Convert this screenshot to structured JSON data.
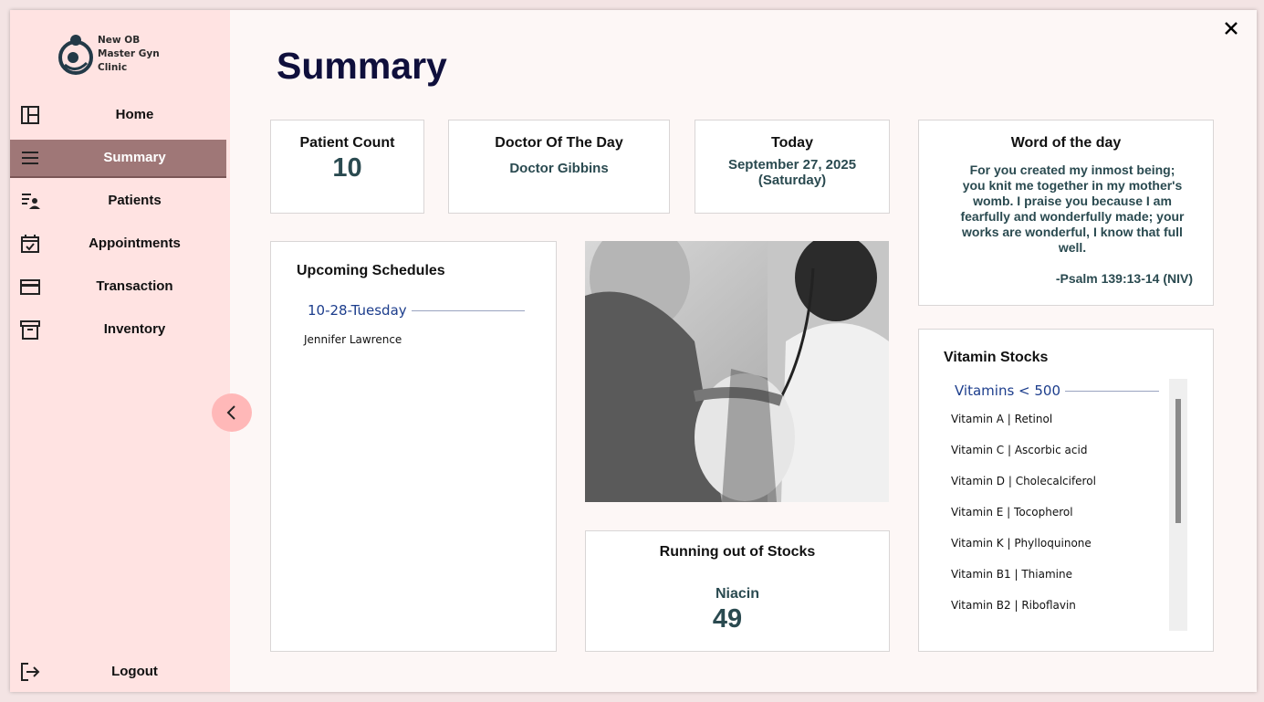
{
  "app": {
    "logo_text": "New OB\nMaster Gyn\nClinic"
  },
  "sidebar": {
    "items": [
      {
        "label": "Home",
        "icon": "dashboard-icon"
      },
      {
        "label": "Summary",
        "icon": "menu-lines-icon",
        "active": true
      },
      {
        "label": "Patients",
        "icon": "patients-list-icon"
      },
      {
        "label": "Appointments",
        "icon": "calendar-check-icon"
      },
      {
        "label": "Transaction",
        "icon": "credit-card-icon"
      },
      {
        "label": "Inventory",
        "icon": "archive-box-icon"
      }
    ],
    "logout_label": "Logout",
    "accent_color": "#9f7777",
    "background_color": "#ffe3e2"
  },
  "page": {
    "title": "Summary"
  },
  "patient_count": {
    "title": "Patient Count",
    "value": "10"
  },
  "doctor_of_day": {
    "title": "Doctor Of The Day",
    "value": "Doctor Gibbins"
  },
  "today": {
    "title": "Today",
    "date": "September 27, 2025",
    "weekday": "(Saturday)"
  },
  "word_of_day": {
    "title": "Word of the day",
    "text": "For you created my inmost being; you knit me together in my mother's womb. I praise you because I am fearfully and wonderfully made; your works are wonderful, I know that full well.",
    "reference": "-Psalm 139:13-14 (NIV)"
  },
  "upcoming": {
    "title": "Upcoming Schedules",
    "group_label": "10-28-Tuesday",
    "items": [
      "Jennifer Lawrence"
    ]
  },
  "running_out": {
    "title": "Running out of Stocks",
    "item": "Niacin",
    "count": "49"
  },
  "vitamin_stocks": {
    "title": "Vitamin Stocks",
    "group_label": "Vitamins < 500",
    "items": [
      "Vitamin A | Retinol",
      "Vitamin C | Ascorbic acid",
      "Vitamin D | Cholecalciferol",
      "Vitamin E | Tocopherol",
      "Vitamin K | Phylloquinone",
      "Vitamin B1 | Thiamine",
      "Vitamin B2 | Riboflavin"
    ]
  }
}
